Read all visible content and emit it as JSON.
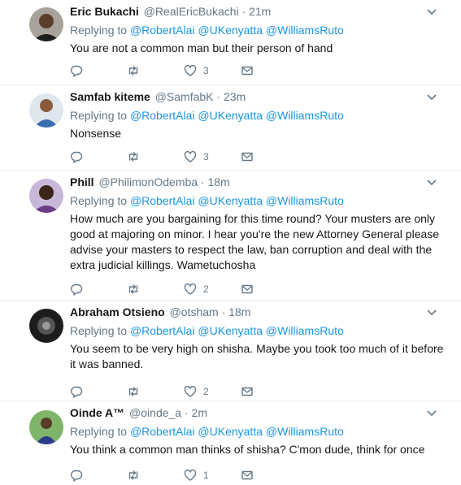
{
  "tweets": [
    {
      "name": "Eric Bukachi",
      "handle": "@RealEricBukachi",
      "time": "21m",
      "replying_label": "Replying to",
      "mentions": [
        "@RobertAlai",
        "@UKenyatta",
        "@WilliamsRuto"
      ],
      "text": "You are not a common man but their person of hand",
      "likes": "3"
    },
    {
      "name": "Samfab kiteme",
      "handle": "@SamfabK",
      "time": "23m",
      "replying_label": "Replying to",
      "mentions": [
        "@RobertAlai",
        "@UKenyatta",
        "@WilliamsRuto"
      ],
      "text": "Nonsense",
      "likes": "3"
    },
    {
      "name": "Phill",
      "handle": "@PhilimonOdemba",
      "time": "18m",
      "replying_label": "Replying to",
      "mentions": [
        "@RobertAlai",
        "@UKenyatta",
        "@WilliamsRuto"
      ],
      "text": "How much are you bargaining for this time round? Your musters are only good at majoring on minor. I hear you're the new Attorney General please advise your masters to respect the law, ban corruption and deal with the extra judicial killings. Wametuchosha",
      "likes": "2"
    },
    {
      "name": "Abraham Otsieno",
      "handle": "@otsham",
      "time": "18m",
      "replying_label": "Replying to",
      "mentions": [
        "@RobertAlai",
        "@UKenyatta",
        "@WilliamsRuto"
      ],
      "text": "You seem to be very high on shisha. Maybe you took too much of it before it was banned.",
      "likes": "2"
    },
    {
      "name": "Oinde A™",
      "handle": "@oinde_a",
      "time": "2m",
      "replying_label": "Replying to",
      "mentions": [
        "@RobertAlai",
        "@UKenyatta",
        "@WilliamsRuto"
      ],
      "text": "You think a common man thinks of shisha? C'mon dude, think for once",
      "likes": "1"
    }
  ],
  "separator": "·",
  "icons": {
    "reply": "reply-icon",
    "retweet": "retweet-icon",
    "like": "heart-icon",
    "dm": "envelope-icon",
    "menu": "chevron-down-icon"
  },
  "colors": {
    "link": "#1b95e0",
    "muted": "#657786",
    "text": "#14171a",
    "border": "#e6ecf0"
  }
}
